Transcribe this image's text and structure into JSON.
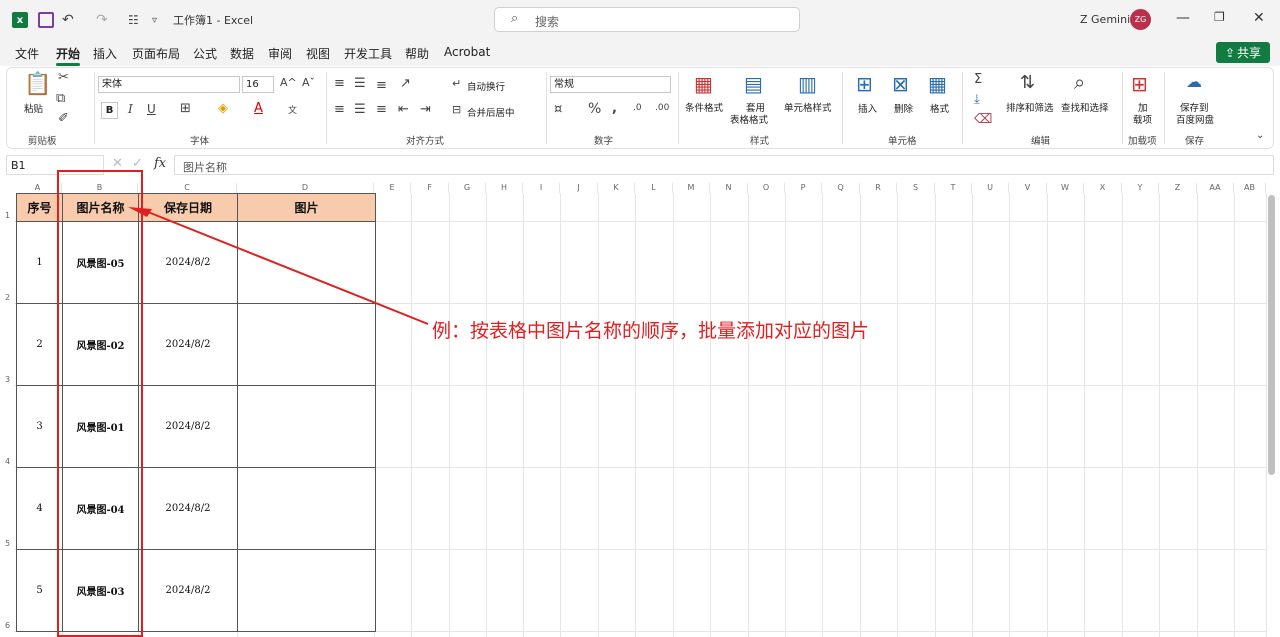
{
  "titlebar": {
    "doc_title": "工作簿1 - Excel",
    "search_placeholder": "搜索",
    "user_name": "Z Gemini",
    "avatar_initials": "ZG"
  },
  "menu": {
    "items": [
      "文件",
      "开始",
      "插入",
      "页面布局",
      "公式",
      "数据",
      "审阅",
      "视图",
      "开发工具",
      "帮助",
      "Acrobat"
    ],
    "active": "开始",
    "share_label": "共享"
  },
  "ribbon": {
    "clipboard": {
      "paste": "粘贴",
      "group": "剪贴板"
    },
    "font": {
      "name": "宋体",
      "size": "16",
      "bold": "B",
      "italic": "I",
      "underline": "U",
      "group": "字体"
    },
    "alignment": {
      "wrap": "自动换行",
      "merge": "合并后居中",
      "group": "对齐方式"
    },
    "number": {
      "format": "常规",
      "group": "数字"
    },
    "styles": {
      "conditional": "条件格式",
      "table": "套用",
      "table2": "表格格式",
      "cell_styles": "单元格样式",
      "group": "样式"
    },
    "cells": {
      "insert": "插入",
      "delete": "删除",
      "format": "格式",
      "group": "单元格"
    },
    "editing": {
      "sort": "排序和筛选",
      "find": "查找和选择",
      "group": "编辑"
    },
    "addins": {
      "label1": "加",
      "label2": "载项",
      "group": "加载项"
    },
    "save": {
      "label1": "保存到",
      "label2": "百度网盘",
      "group": "保存"
    }
  },
  "formula_bar": {
    "name_box": "B1",
    "fx": "fx",
    "content": "图片名称"
  },
  "columns": [
    "A",
    "B",
    "C",
    "D",
    "E",
    "F",
    "G",
    "H",
    "I",
    "J",
    "K",
    "L",
    "M",
    "N",
    "O",
    "P",
    "Q",
    "R",
    "S",
    "T",
    "U",
    "V",
    "W",
    "X",
    "Y",
    "Z",
    "AA",
    "AB"
  ],
  "rows": [
    "1",
    "2",
    "3",
    "4",
    "5",
    "6"
  ],
  "table": {
    "headers": [
      "序号",
      "图片名称",
      "保存日期",
      "图片"
    ],
    "rows": [
      [
        "1",
        "风景图-05",
        "2024/8/2",
        ""
      ],
      [
        "2",
        "风景图-02",
        "2024/8/2",
        ""
      ],
      [
        "3",
        "风景图-01",
        "2024/8/2",
        ""
      ],
      [
        "4",
        "风景图-04",
        "2024/8/2",
        ""
      ],
      [
        "5",
        "风景图-03",
        "2024/8/2",
        ""
      ]
    ]
  },
  "annotation": "例：按表格中图片名称的顺序，批量添加对应的图片",
  "colors": {
    "accent": "#107c41",
    "header_fill": "#f8cbad",
    "annotation": "#e02020"
  }
}
